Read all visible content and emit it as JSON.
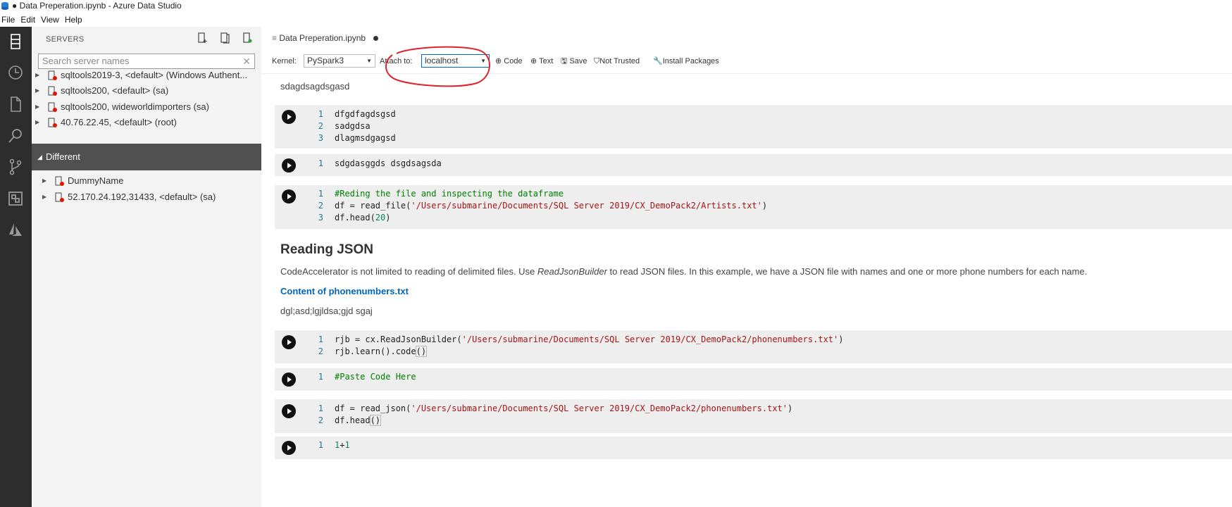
{
  "window": {
    "title": "● Data Preperation.ipynb - Azure Data Studio"
  },
  "menu": [
    "File",
    "Edit",
    "View",
    "Help"
  ],
  "activity_bar": [
    {
      "icon": "servers-icon"
    },
    {
      "icon": "history-icon"
    },
    {
      "icon": "explorer-icon"
    },
    {
      "icon": "search-icon"
    },
    {
      "icon": "source-control-icon"
    },
    {
      "icon": "extensions-icon"
    },
    {
      "icon": "azure-icon"
    }
  ],
  "sidebar": {
    "header": "SERVERS",
    "search_placeholder": "Search server names",
    "servers": [
      "sqltools2019-3, <default> (Windows Authent...",
      "sqltools200, <default> (sa)",
      "sqltools200, wideworldimporters (sa)",
      "40.76.22.45, <default> (root)"
    ],
    "group": {
      "label": "Different",
      "servers": [
        "DummyName",
        "52.170.24.192,31433, <default> (sa)"
      ]
    },
    "status_color": "#e51400"
  },
  "tab": {
    "label": "Data Preperation.ipynb"
  },
  "toolbar": {
    "kernel_label": "Kernel:",
    "kernel_value": "PySpark3",
    "attach_label": "Attach to:",
    "attach_value": "localhost",
    "code_label": "Code",
    "text_label": "Text",
    "save_label": "Save",
    "trust_label": "Not Trusted",
    "install_label": "Install Packages"
  },
  "notebook": {
    "md1": "sdagdsagdsgasd",
    "cell1": [
      "dfgdfagdsgsd",
      "sadgdsa",
      "dlagmsdgagsd"
    ],
    "cell2": [
      "sdgdasggds dsgdsagsda"
    ],
    "cell3": {
      "l1": "#Reding the file and inspecting the dataframe",
      "l2_pre": "df = read_file(",
      "l2_str": "'/Users/submarine/Documents/SQL Server 2019/CX_DemoPack2/Artists.txt'",
      "l2_post": ")",
      "l3_pre": "df.head(",
      "l3_num": "20",
      "l3_post": ")"
    },
    "heading": "Reading JSON",
    "para_a": "CodeAccelerator is not limited to reading of delimited files. Use ",
    "para_em": "ReadJsonBuilder",
    "para_b": " to read JSON files. In this example, we have a JSON file with names and one or more phone numbers for each name.",
    "subheading": "Content of phonenumbers.txt",
    "md2": "dgl;asd;lgjldsa;gjd sgaj",
    "cell4": {
      "l1_pre": "rjb = cx.ReadJsonBuilder(",
      "l1_str": "'/Users/submarine/Documents/SQL Server 2019/CX_DemoPack2/phonenumbers.txt'",
      "l1_post": ")",
      "l2_pre": "rjb.learn().code",
      "l2_brk": "()"
    },
    "cell5": "#Paste Code Here",
    "cell6": {
      "l1_pre": "df = read_json(",
      "l1_str": "'/Users/submarine/Documents/SQL Server 2019/CX_DemoPack2/phonenumbers.txt'",
      "l1_post": ")",
      "l2_pre": "df.head",
      "l2_brk": "()"
    },
    "cell7": {
      "a": "1",
      "op": "+",
      "b": "1"
    }
  },
  "line_numbers": [
    "1",
    "2",
    "3"
  ],
  "annotation_color": "#e0202a"
}
